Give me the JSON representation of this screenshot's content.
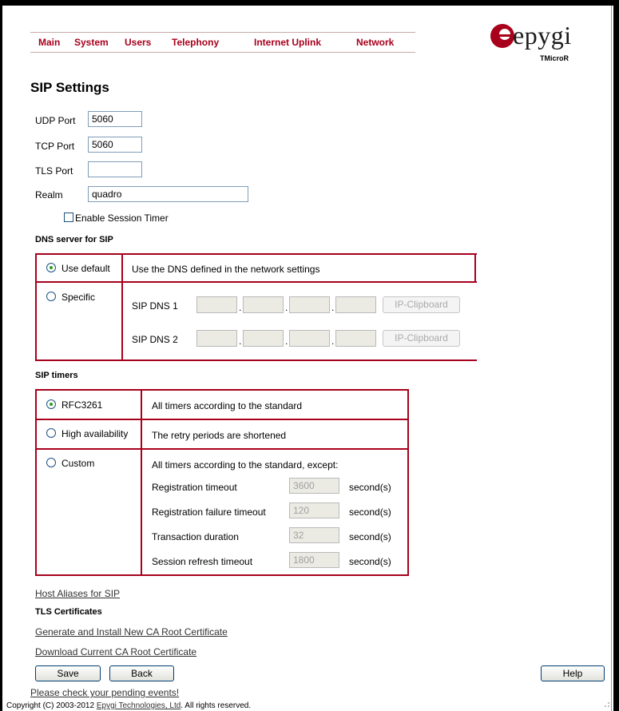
{
  "nav": {
    "items": [
      "Main",
      "System",
      "Users",
      "Telephony",
      "Internet Uplink",
      "Network"
    ]
  },
  "logo": {
    "text": "epygi",
    "sub": "TMicroR"
  },
  "page_title": "SIP Settings",
  "ports": {
    "udp_label": "UDP Port",
    "udp_value": "5060",
    "tcp_label": "TCP Port",
    "tcp_value": "5060",
    "tls_label": "TLS Port",
    "tls_value": "",
    "realm_label": "Realm",
    "realm_value": "quadro"
  },
  "session_timer": {
    "label": "Enable Session Timer",
    "checked": false
  },
  "dns": {
    "heading": "DNS server for SIP",
    "use_default_label": "Use default",
    "use_default_desc": "Use the DNS defined in the network settings",
    "specific_label": "Specific",
    "dns1_label": "SIP DNS 1",
    "dns2_label": "SIP DNS 2",
    "dot": ".",
    "clipboard_label": "IP-Clipboard"
  },
  "timers": {
    "heading": "SIP timers",
    "rfc_label": "RFC3261",
    "rfc_desc": "All timers according to the standard",
    "ha_label": "High availability",
    "ha_desc": "The retry periods are shortened",
    "custom_label": "Custom",
    "custom_desc": "All timers according to the standard, except:",
    "rows": [
      {
        "label": "Registration timeout",
        "value": "3600",
        "unit": "second(s)"
      },
      {
        "label": "Registration failure timeout",
        "value": "120",
        "unit": "second(s)"
      },
      {
        "label": "Transaction duration",
        "value": "32",
        "unit": "second(s)"
      },
      {
        "label": "Session refresh timeout",
        "value": "1800",
        "unit": "second(s)"
      }
    ]
  },
  "links": {
    "host_aliases": "Host Aliases for SIP",
    "tls_heading": "TLS Certificates",
    "generate_cert": "Generate and Install New CA Root Certificate",
    "download_cert": "Download Current CA Root Certificate",
    "pending_events": "Please check your pending events!"
  },
  "buttons": {
    "save": "Save",
    "back": "Back",
    "help": "Help"
  },
  "footer": {
    "prefix": "Copyright (C) 2003-2012 ",
    "company": "Epygi Technologies, Ltd",
    "suffix": ". All rights reserved."
  },
  "colors": {
    "accent": "#a8001c",
    "radio_selected": "#21a121"
  }
}
